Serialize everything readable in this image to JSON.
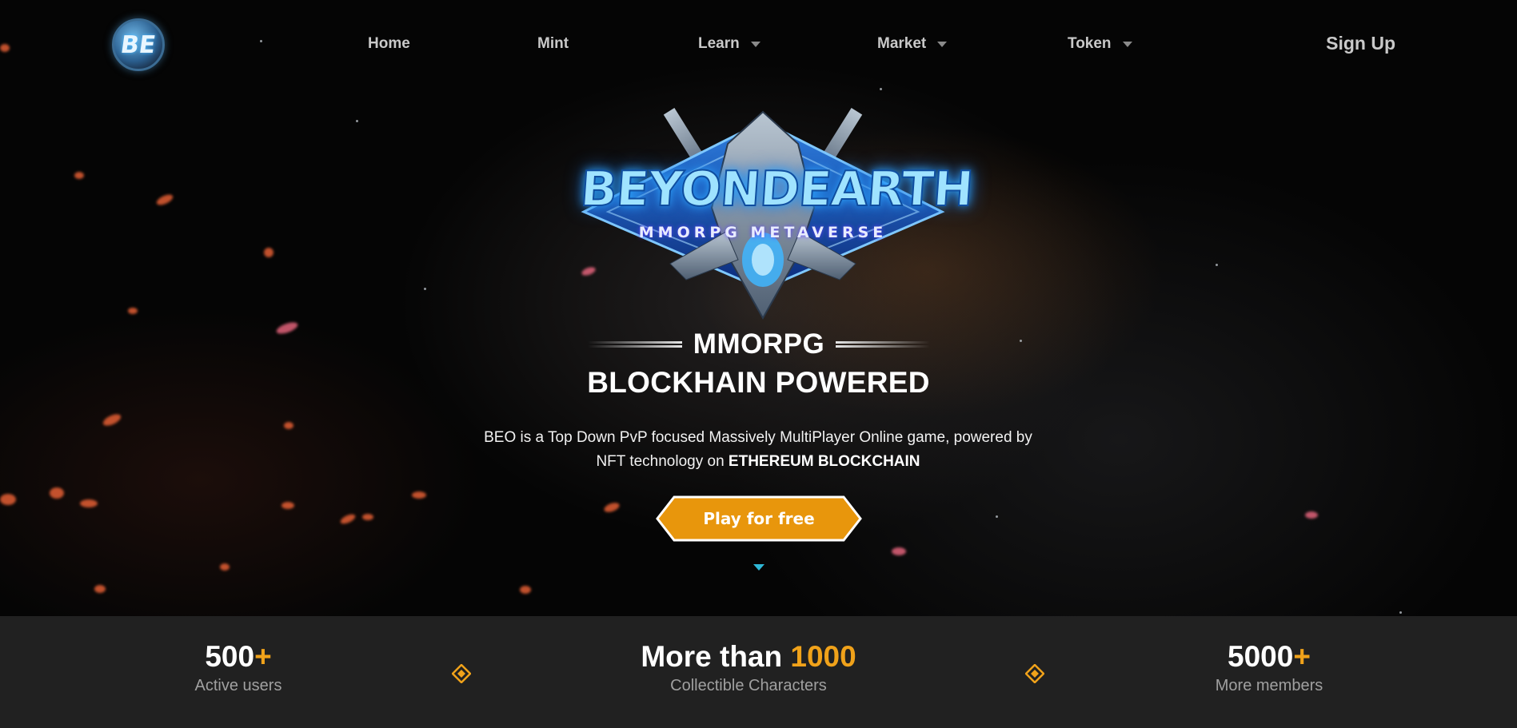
{
  "nav": {
    "logo_text": "BE",
    "items": [
      {
        "label": "Home",
        "dropdown": false
      },
      {
        "label": "Mint",
        "dropdown": false
      },
      {
        "label": "Learn",
        "dropdown": true
      },
      {
        "label": "Market",
        "dropdown": true
      },
      {
        "label": "Token",
        "dropdown": true
      }
    ],
    "signup_label": "Sign Up"
  },
  "hero": {
    "emblem_title": "BEYONDEARTH",
    "emblem_subtitle": "MMORPG METAVERSE",
    "headline_1": "MMORPG",
    "headline_2": "BLOCKHAIN POWERED",
    "description_line1": "BEO is a Top Down PvP focused Massively MultiPlayer Online game, powered by",
    "description_line2_prefix": "NFT technology on ",
    "description_line2_bold": "ETHEREUM BLOCKCHAIN",
    "cta_label": "Play for free"
  },
  "stats": [
    {
      "prefix": "",
      "number": "500",
      "suffix": "+",
      "label": "Active users"
    },
    {
      "prefix": "More than ",
      "number": "1000",
      "suffix": "",
      "label": "Collectible Characters"
    },
    {
      "prefix": "",
      "number": "5000",
      "suffix": "+",
      "label": "More members"
    }
  ],
  "colors": {
    "accent_orange": "#f0a21a",
    "cta_fill": "#e8960c",
    "stats_bg": "#212121",
    "arrow_cyan": "#2fb7d6"
  },
  "icons": {
    "logo": "be-globe-logo",
    "dropdown": "caret-down-icon",
    "stat_separator": "diamond-icon",
    "scroll": "scroll-down-arrow-icon"
  }
}
